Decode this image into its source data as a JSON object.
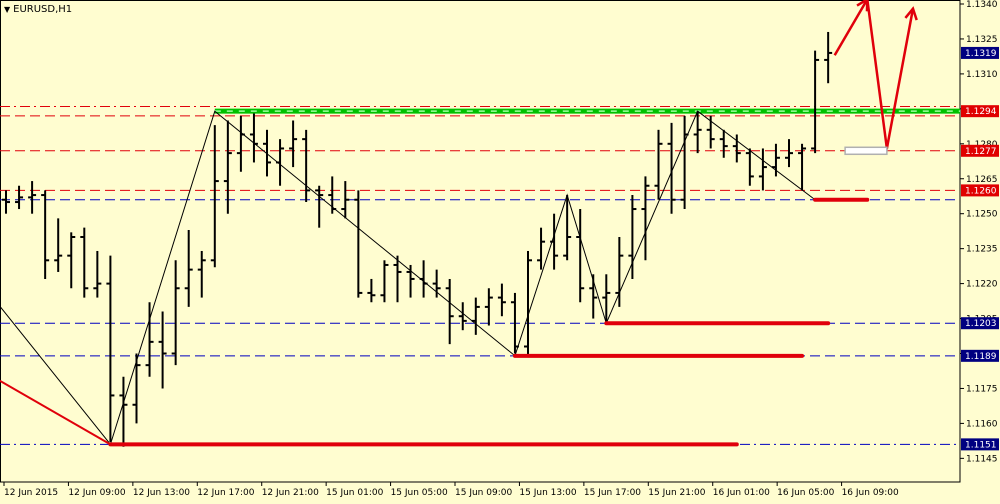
{
  "header": {
    "symbol_label": "EURUSD,H1",
    "dropdown_icon": "triangle-down-icon"
  },
  "colors": {
    "background": "#fffdd0",
    "bars": "#000000",
    "red_line": "#e0000b",
    "green_line": "#00c000",
    "blue_dashed": "#0000c0",
    "label_navy": "#000080",
    "label_red": "#e00000",
    "gray_label": "#b0b0b0"
  },
  "chart_data": {
    "type": "ohlc",
    "symbol": "EURUSD",
    "timeframe": "H1",
    "ylim": [
      1.114,
      1.134
    ],
    "y_ticks": [
      "1.1340",
      "1.1325",
      "1.1310",
      "1.1295",
      "1.1280",
      "1.1265",
      "1.1250",
      "1.1235",
      "1.1220",
      "1.1205",
      "1.1190",
      "1.1175",
      "1.1160",
      "1.1145"
    ],
    "x_ticks": [
      "12 Jun 2015",
      "12 Jun 09:00",
      "12 Jun 13:00",
      "12 Jun 17:00",
      "12 Jun 21:00",
      "15 Jun 01:00",
      "15 Jun 05:00",
      "15 Jun 09:00",
      "15 Jun 13:00",
      "15 Jun 17:00",
      "15 Jun 21:00",
      "16 Jun 01:00",
      "16 Jun 05:00",
      "16 Jun 09:00"
    ],
    "bar_count": 64,
    "bars": [
      {
        "i": 0,
        "o": 1.1256,
        "h": 1.126,
        "l": 1.125,
        "c": 1.1255
      },
      {
        "i": 1,
        "o": 1.1255,
        "h": 1.1262,
        "l": 1.1252,
        "c": 1.1257
      },
      {
        "i": 2,
        "o": 1.1257,
        "h": 1.1264,
        "l": 1.125,
        "c": 1.1258
      },
      {
        "i": 3,
        "o": 1.1258,
        "h": 1.126,
        "l": 1.1222,
        "c": 1.123
      },
      {
        "i": 4,
        "o": 1.123,
        "h": 1.1248,
        "l": 1.1225,
        "c": 1.1232
      },
      {
        "i": 5,
        "o": 1.1232,
        "h": 1.1242,
        "l": 1.1218,
        "c": 1.124
      },
      {
        "i": 6,
        "o": 1.124,
        "h": 1.1244,
        "l": 1.1214,
        "c": 1.1218
      },
      {
        "i": 7,
        "o": 1.1218,
        "h": 1.1234,
        "l": 1.1214,
        "c": 1.122
      },
      {
        "i": 8,
        "o": 1.122,
        "h": 1.1232,
        "l": 1.1152,
        "c": 1.1172
      },
      {
        "i": 9,
        "o": 1.1172,
        "h": 1.118,
        "l": 1.115,
        "c": 1.1168
      },
      {
        "i": 10,
        "o": 1.1168,
        "h": 1.119,
        "l": 1.116,
        "c": 1.1185
      },
      {
        "i": 11,
        "o": 1.1185,
        "h": 1.1212,
        "l": 1.118,
        "c": 1.1195
      },
      {
        "i": 12,
        "o": 1.1195,
        "h": 1.1208,
        "l": 1.1175,
        "c": 1.119
      },
      {
        "i": 13,
        "o": 1.119,
        "h": 1.123,
        "l": 1.1185,
        "c": 1.1218
      },
      {
        "i": 14,
        "o": 1.1218,
        "h": 1.1243,
        "l": 1.121,
        "c": 1.1226
      },
      {
        "i": 15,
        "o": 1.1226,
        "h": 1.1234,
        "l": 1.1214,
        "c": 1.123
      },
      {
        "i": 16,
        "o": 1.123,
        "h": 1.1288,
        "l": 1.1227,
        "c": 1.1264
      },
      {
        "i": 17,
        "o": 1.1264,
        "h": 1.129,
        "l": 1.125,
        "c": 1.1276
      },
      {
        "i": 18,
        "o": 1.1276,
        "h": 1.1292,
        "l": 1.1268,
        "c": 1.1284
      },
      {
        "i": 19,
        "o": 1.1284,
        "h": 1.1293,
        "l": 1.1272,
        "c": 1.128
      },
      {
        "i": 20,
        "o": 1.128,
        "h": 1.1286,
        "l": 1.1266,
        "c": 1.1272
      },
      {
        "i": 21,
        "o": 1.1272,
        "h": 1.1282,
        "l": 1.1262,
        "c": 1.1278
      },
      {
        "i": 22,
        "o": 1.1278,
        "h": 1.129,
        "l": 1.127,
        "c": 1.1282
      },
      {
        "i": 23,
        "o": 1.1282,
        "h": 1.1286,
        "l": 1.1255,
        "c": 1.126
      },
      {
        "i": 24,
        "o": 1.126,
        "h": 1.1262,
        "l": 1.1244,
        "c": 1.1258
      },
      {
        "i": 25,
        "o": 1.1258,
        "h": 1.1266,
        "l": 1.125,
        "c": 1.1252
      },
      {
        "i": 26,
        "o": 1.1252,
        "h": 1.1264,
        "l": 1.1248,
        "c": 1.1256
      },
      {
        "i": 27,
        "o": 1.1256,
        "h": 1.126,
        "l": 1.1214,
        "c": 1.1216
      },
      {
        "i": 28,
        "o": 1.1216,
        "h": 1.1222,
        "l": 1.1212,
        "c": 1.1215
      },
      {
        "i": 29,
        "o": 1.1215,
        "h": 1.123,
        "l": 1.1212,
        "c": 1.1228
      },
      {
        "i": 30,
        "o": 1.1228,
        "h": 1.1232,
        "l": 1.1212,
        "c": 1.1225
      },
      {
        "i": 31,
        "o": 1.1225,
        "h": 1.1228,
        "l": 1.1214,
        "c": 1.1222
      },
      {
        "i": 32,
        "o": 1.1222,
        "h": 1.123,
        "l": 1.1214,
        "c": 1.122
      },
      {
        "i": 33,
        "o": 1.122,
        "h": 1.1226,
        "l": 1.1214,
        "c": 1.1218
      },
      {
        "i": 34,
        "o": 1.1218,
        "h": 1.1222,
        "l": 1.1194,
        "c": 1.1206
      },
      {
        "i": 35,
        "o": 1.1206,
        "h": 1.1212,
        "l": 1.12,
        "c": 1.1204
      },
      {
        "i": 36,
        "o": 1.1204,
        "h": 1.1214,
        "l": 1.1198,
        "c": 1.121
      },
      {
        "i": 37,
        "o": 1.121,
        "h": 1.1218,
        "l": 1.1202,
        "c": 1.1214
      },
      {
        "i": 38,
        "o": 1.1214,
        "h": 1.122,
        "l": 1.1206,
        "c": 1.1212
      },
      {
        "i": 39,
        "o": 1.1212,
        "h": 1.1216,
        "l": 1.119,
        "c": 1.1193
      },
      {
        "i": 40,
        "o": 1.1193,
        "h": 1.1234,
        "l": 1.1189,
        "c": 1.123
      },
      {
        "i": 41,
        "o": 1.123,
        "h": 1.1244,
        "l": 1.1226,
        "c": 1.1238
      },
      {
        "i": 42,
        "o": 1.1238,
        "h": 1.125,
        "l": 1.1226,
        "c": 1.1232
      },
      {
        "i": 43,
        "o": 1.1232,
        "h": 1.1258,
        "l": 1.123,
        "c": 1.124
      },
      {
        "i": 44,
        "o": 1.124,
        "h": 1.1252,
        "l": 1.1212,
        "c": 1.1218
      },
      {
        "i": 45,
        "o": 1.1218,
        "h": 1.1224,
        "l": 1.1205,
        "c": 1.1214
      },
      {
        "i": 46,
        "o": 1.1214,
        "h": 1.1224,
        "l": 1.1203,
        "c": 1.1216
      },
      {
        "i": 47,
        "o": 1.1216,
        "h": 1.124,
        "l": 1.121,
        "c": 1.1232
      },
      {
        "i": 48,
        "o": 1.1232,
        "h": 1.1258,
        "l": 1.1222,
        "c": 1.1252
      },
      {
        "i": 49,
        "o": 1.1252,
        "h": 1.1266,
        "l": 1.123,
        "c": 1.1262
      },
      {
        "i": 50,
        "o": 1.1262,
        "h": 1.1286,
        "l": 1.1256,
        "c": 1.128
      },
      {
        "i": 51,
        "o": 1.128,
        "h": 1.1289,
        "l": 1.125,
        "c": 1.1256
      },
      {
        "i": 52,
        "o": 1.1256,
        "h": 1.1292,
        "l": 1.1252,
        "c": 1.1284
      },
      {
        "i": 53,
        "o": 1.1284,
        "h": 1.1294,
        "l": 1.1276,
        "c": 1.1286
      },
      {
        "i": 54,
        "o": 1.1286,
        "h": 1.1292,
        "l": 1.1278,
        "c": 1.1282
      },
      {
        "i": 55,
        "o": 1.1282,
        "h": 1.1286,
        "l": 1.1274,
        "c": 1.1279
      },
      {
        "i": 56,
        "o": 1.1279,
        "h": 1.1284,
        "l": 1.1272,
        "c": 1.1276
      },
      {
        "i": 57,
        "o": 1.1276,
        "h": 1.1278,
        "l": 1.1262,
        "c": 1.1266
      },
      {
        "i": 58,
        "o": 1.1266,
        "h": 1.1278,
        "l": 1.126,
        "c": 1.127
      },
      {
        "i": 59,
        "o": 1.127,
        "h": 1.128,
        "l": 1.1266,
        "c": 1.1274
      },
      {
        "i": 60,
        "o": 1.1274,
        "h": 1.1282,
        "l": 1.127,
        "c": 1.1276
      },
      {
        "i": 61,
        "o": 1.1276,
        "h": 1.128,
        "l": 1.126,
        "c": 1.1278
      },
      {
        "i": 62,
        "o": 1.1278,
        "h": 1.132,
        "l": 1.1276,
        "c": 1.1316
      },
      {
        "i": 63,
        "o": 1.1316,
        "h": 1.1328,
        "l": 1.1306,
        "c": 1.1319
      }
    ],
    "price_labels": [
      {
        "value": 1.1319,
        "text": "1.1319",
        "style": "navy"
      },
      {
        "value": 1.1294,
        "text": "1.1294",
        "style": "red"
      },
      {
        "value": 1.1277,
        "text": "1.1277",
        "style": "red"
      },
      {
        "value": 1.126,
        "text": "1.1260",
        "style": "red"
      },
      {
        "value": 1.1203,
        "text": "1.1203",
        "style": "navy"
      },
      {
        "value": 1.1189,
        "text": "1.1189",
        "style": "navy"
      },
      {
        "value": 1.1151,
        "text": "1.1151",
        "style": "navy"
      }
    ],
    "hlines": [
      {
        "name": "green-resistance",
        "value": 1.1294,
        "color": "#00c000",
        "style": "dash-dot-thick",
        "from_bar": 16,
        "to_bar": 64
      },
      {
        "name": "red-dash-dot-1",
        "value": 1.1296,
        "color": "#e0000b",
        "style": "dashdot",
        "from_bar": 0,
        "to_bar": 64
      },
      {
        "name": "red-dash-1",
        "value": 1.1292,
        "color": "#e0000b",
        "style": "dash",
        "from_bar": 0,
        "to_bar": 64
      },
      {
        "name": "red-dash-2",
        "value": 1.1277,
        "color": "#e0000b",
        "style": "dash",
        "from_bar": 0,
        "to_bar": 64
      },
      {
        "name": "red-dash-3",
        "value": 1.126,
        "color": "#e0000b",
        "style": "dash",
        "from_bar": 0,
        "to_bar": 64
      },
      {
        "name": "blue-dash-1",
        "value": 1.1256,
        "color": "#0000c0",
        "style": "dash",
        "from_bar": 0,
        "to_bar": 64
      },
      {
        "name": "blue-dash-2",
        "value": 1.1203,
        "color": "#0000c0",
        "style": "dash",
        "from_bar": 0,
        "to_bar": 64
      },
      {
        "name": "blue-dash-3",
        "value": 1.1189,
        "color": "#0000c0",
        "style": "dash",
        "from_bar": 0,
        "to_bar": 64
      },
      {
        "name": "blue-dashdot-4",
        "value": 1.1151,
        "color": "#0000c0",
        "style": "dashdot",
        "from_bar": 0,
        "to_bar": 64
      }
    ],
    "support_lines": [
      {
        "name": "support-1151",
        "value": 1.1151,
        "from_bar": 8,
        "to_bar": 56
      },
      {
        "name": "support-1189",
        "value": 1.1189,
        "from_bar": 39,
        "to_bar": 61
      },
      {
        "name": "support-1203",
        "value": 1.1203,
        "from_bar": 46,
        "to_bar": 63
      },
      {
        "name": "support-1256",
        "value": 1.1256,
        "from_bar": 62,
        "to_bar": 66
      }
    ],
    "zigzag": [
      {
        "bar": -1,
        "price": 1.1214
      },
      {
        "bar": 8,
        "price": 1.1151
      },
      {
        "bar": 16,
        "price": 1.1294
      },
      {
        "bar": 39,
        "price": 1.1189
      },
      {
        "bar": 43,
        "price": 1.1258
      },
      {
        "bar": 46,
        "price": 1.1203
      },
      {
        "bar": 53,
        "price": 1.1294
      },
      {
        "bar": 62,
        "price": 1.1256
      }
    ],
    "red_diag": [
      {
        "bar": -1,
        "price": 1.118
      },
      {
        "bar": 8,
        "price": 1.1151
      }
    ],
    "forecast": [
      {
        "bar": 63.5,
        "price": 1.1318
      },
      {
        "bar": 66,
        "price": 1.1342
      },
      {
        "bar": 67.5,
        "price": 1.1278
      },
      {
        "bar": 69.5,
        "price": 1.1338
      }
    ],
    "gray_marker": {
      "value": 1.1277,
      "from_bar": 64.3,
      "to_bar": 67.5
    }
  }
}
